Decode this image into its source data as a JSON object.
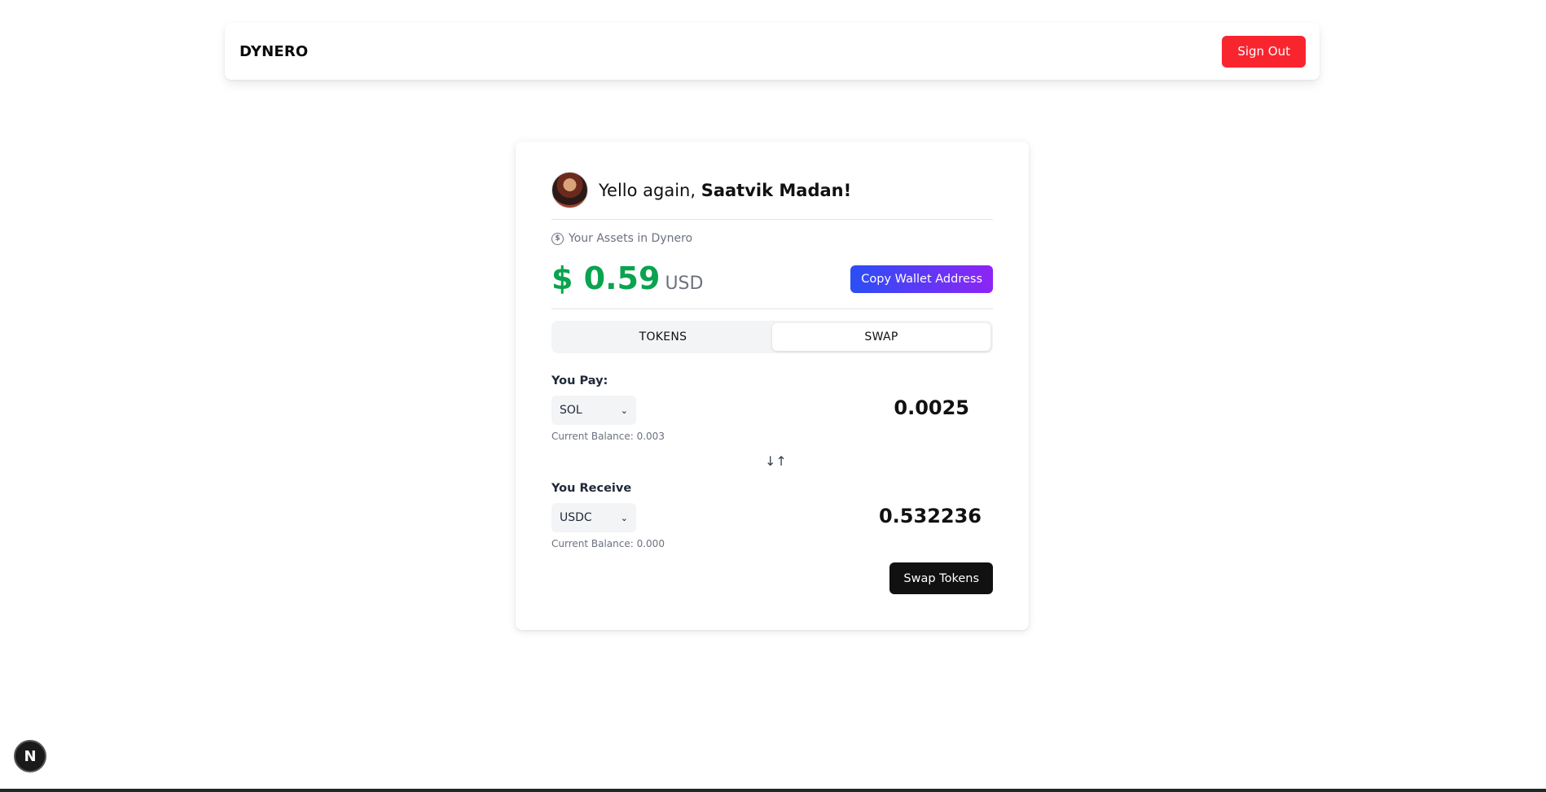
{
  "header": {
    "brand": "DYNERO",
    "sign_out_label": "Sign Out"
  },
  "profile": {
    "greeting_prefix": "Yello again, ",
    "user_name": "Saatvik Madan!"
  },
  "assets": {
    "label": "Your Assets in Dynero",
    "amount": "$ 0.59",
    "currency": "USD",
    "copy_wallet_label": "Copy Wallet Address"
  },
  "tabs": [
    {
      "label": "TOKENS",
      "active": false
    },
    {
      "label": "SWAP",
      "active": true
    }
  ],
  "swap": {
    "pay": {
      "label": "You Pay:",
      "token": "SOL",
      "amount": "0.0025",
      "balance": "Current Balance: 0.003"
    },
    "receive": {
      "label": "You Receive",
      "token": "USDC",
      "amount": "0.532236",
      "balance": "Current Balance: 0.000"
    },
    "submit_label": "Swap Tokens"
  },
  "dev_badge": {
    "letter": "N"
  },
  "colors": {
    "sign_out": "#f8252f",
    "balance_green": "#0aa34f",
    "gradient_start": "#2b4ef5",
    "gradient_end": "#8e24f5",
    "swap_button": "#111111"
  }
}
